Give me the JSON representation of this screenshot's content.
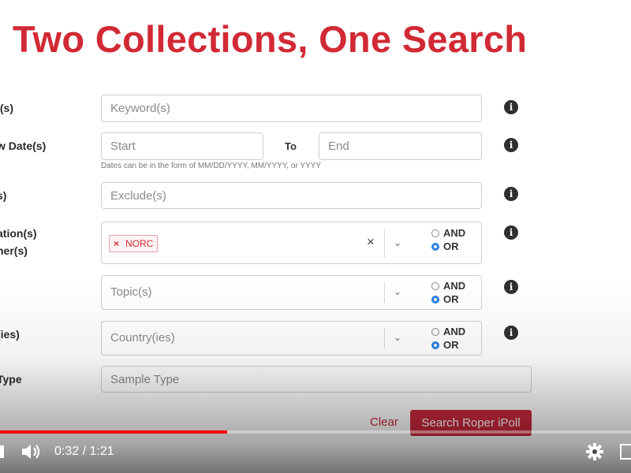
{
  "slide": {
    "title": "Two Collections, One Search"
  },
  "form": {
    "keywords": {
      "label": "l(s)",
      "placeholder": "Keyword(s)"
    },
    "dates": {
      "label": "w Date(s)",
      "start_placeholder": "Start",
      "to_label": "To",
      "end_placeholder": "End",
      "hint": "Dates can be in the form of MM/DD/YYYY, MM/YYYY, or YYYY"
    },
    "exclude": {
      "label": "s)",
      "placeholder": "Exclude(s)"
    },
    "organizations": {
      "label_line1": "ation(s)",
      "label_line2": "her(s)",
      "tag": "NORC",
      "tag_remove": "×",
      "clear_glyph": "×",
      "and_label": "AND",
      "or_label": "OR",
      "selected": "OR"
    },
    "topics": {
      "placeholder": "Topic(s)",
      "and_label": "AND",
      "or_label": "OR",
      "selected": "OR"
    },
    "countries": {
      "label": "(ies)",
      "placeholder": "Country(ies)",
      "and_label": "AND",
      "or_label": "OR",
      "selected": "OR"
    },
    "sample_type": {
      "label": "Type",
      "placeholder": "Sample Type"
    },
    "clear_label": "Clear",
    "search_label": "Search Roper iPoll"
  },
  "info_glyph": "i",
  "player": {
    "time_current": "0:32",
    "time_total": "1:21",
    "time_separator": "/",
    "progress": 0.36,
    "colors": {
      "progress": "#ff0000",
      "accent": "#c8283a",
      "title": "#d12a34"
    }
  }
}
